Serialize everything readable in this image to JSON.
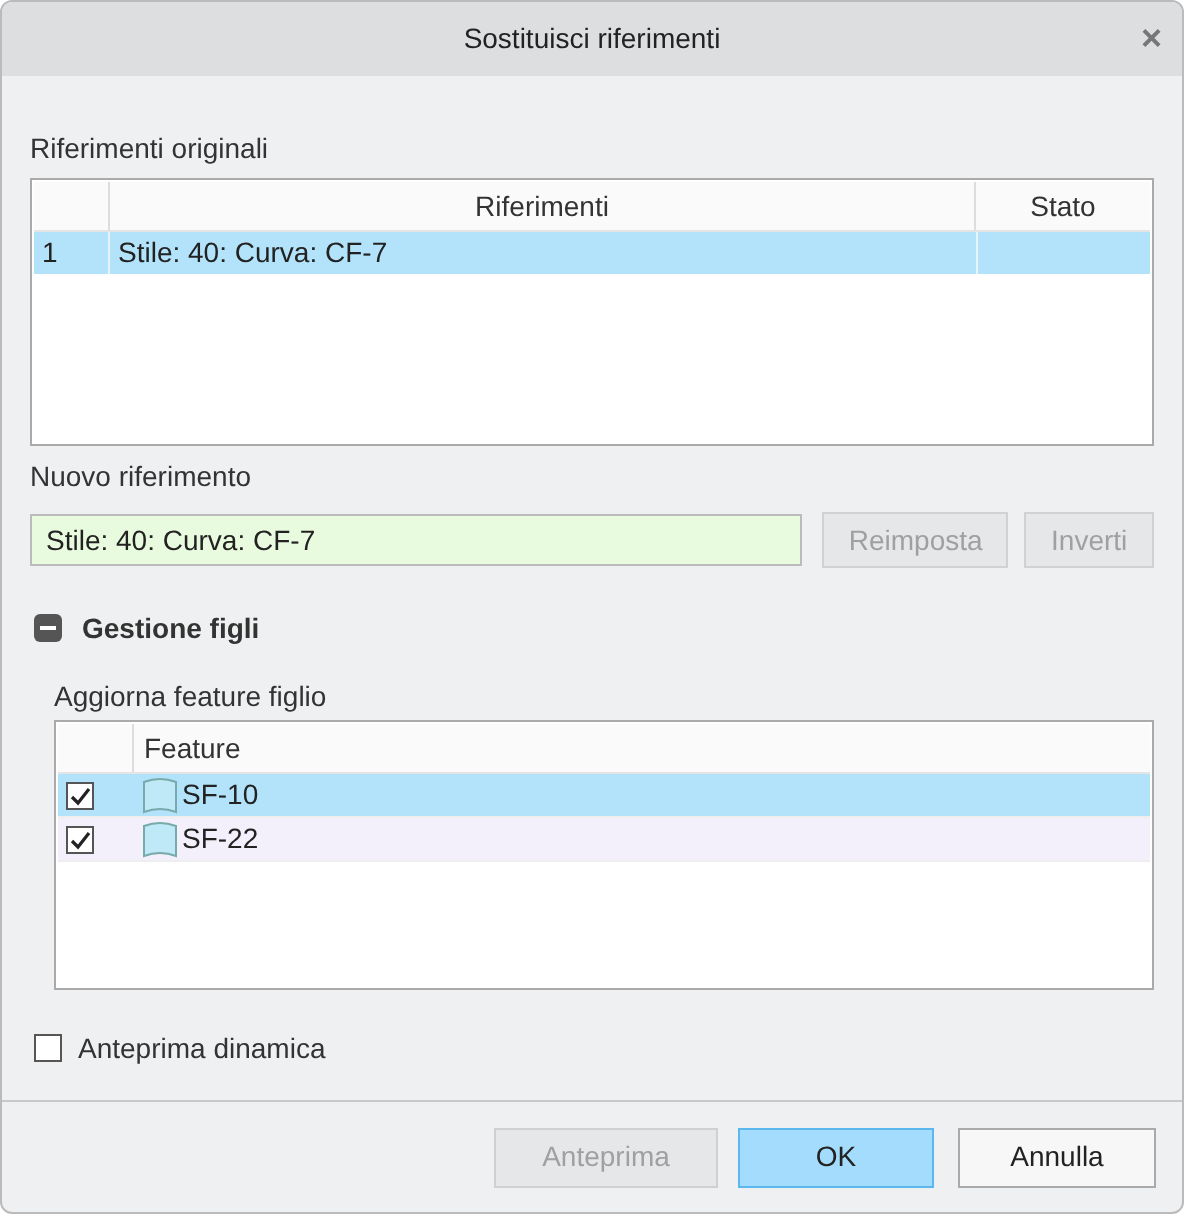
{
  "window": {
    "title": "Sostituisci riferimenti",
    "close": "×"
  },
  "original_references": {
    "label": "Riferimenti originali",
    "columns": [
      "Riferimenti",
      "Stato"
    ],
    "rows": [
      {
        "index": "1",
        "reference": "Stile: 40: Curva: CF-7",
        "selected": true
      }
    ]
  },
  "new_reference": {
    "label": "Nuovo riferimento",
    "value": "Stile: 40: Curva: CF-7",
    "buttons": [
      {
        "label": "Reimposta",
        "disabled": true
      },
      {
        "label": "Inverti",
        "disabled": true
      }
    ]
  },
  "children_section": {
    "title": "Gestione figli",
    "expanded": true,
    "label": "Aggiorna feature figlio",
    "columns": [
      "Feature"
    ],
    "rows": [
      {
        "name": "SF-10",
        "checked": true,
        "selected": true
      },
      {
        "name": "SF-22",
        "checked": true,
        "selected": false
      }
    ]
  },
  "dynamic_preview": {
    "label": "Anteprima dinamica",
    "checked": false
  },
  "buttons": [
    {
      "label": "Anteprima",
      "kind": "disabled"
    },
    {
      "label": "OK",
      "kind": "primary"
    },
    {
      "label": "Annulla",
      "kind": "normal"
    }
  ]
}
